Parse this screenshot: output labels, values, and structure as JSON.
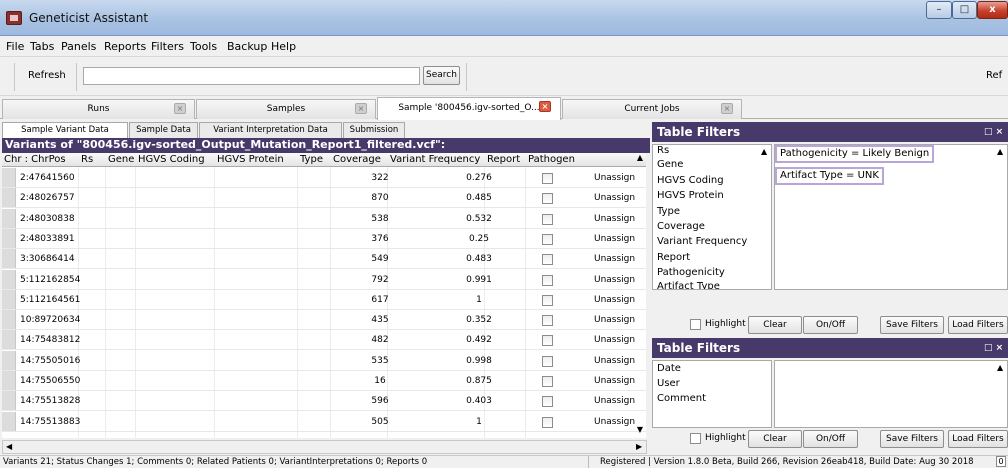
{
  "window": {
    "title": "Geneticist Assistant",
    "minimize": "–",
    "maximize": "□",
    "close": "x"
  },
  "menu": [
    "File",
    "Tabs",
    "Panels",
    "Reports",
    "Filters",
    "Tools",
    "Backup",
    "Help"
  ],
  "toolbar": {
    "refresh": "Refresh",
    "search_value": "",
    "search_button": "Search",
    "right_label": "Ref"
  },
  "tabs": [
    {
      "label": "Runs"
    },
    {
      "label": "Samples"
    },
    {
      "label": "Sample '800456.igv-sorted_O..."
    },
    {
      "label": "Current Jobs"
    }
  ],
  "subtabs": [
    "Sample Variant Data",
    "Sample Data",
    "Variant Interpretation Data",
    "Submission"
  ],
  "variants": {
    "header": "Variants of \"800456.igv-sorted_Output_Mutation_Report1_filtered.vcf\":",
    "columns": [
      "Chr : ChrPos",
      "Rs",
      "Gene",
      "HGVS Coding",
      "HGVS Protein",
      "Type",
      "Coverage",
      "Variant Frequency",
      "Report",
      "Pathogen"
    ],
    "rows": [
      {
        "chr": "2:47641560",
        "coverage": "322",
        "freq": "0.276",
        "path": "Unassign"
      },
      {
        "chr": "2:48026757",
        "coverage": "870",
        "freq": "0.485",
        "path": "Unassign"
      },
      {
        "chr": "2:48030838",
        "coverage": "538",
        "freq": "0.532",
        "path": "Unassign"
      },
      {
        "chr": "2:48033891",
        "coverage": "376",
        "freq": "0.25",
        "path": "Unassign"
      },
      {
        "chr": "3:30686414",
        "coverage": "549",
        "freq": "0.483",
        "path": "Unassign"
      },
      {
        "chr": "5:112162854",
        "coverage": "792",
        "freq": "0.991",
        "path": "Unassign"
      },
      {
        "chr": "5:112164561",
        "coverage": "617",
        "freq": "1",
        "path": "Unassign"
      },
      {
        "chr": "10:89720634",
        "coverage": "435",
        "freq": "0.352",
        "path": "Unassign"
      },
      {
        "chr": "14:75483812",
        "coverage": "482",
        "freq": "0.492",
        "path": "Unassign"
      },
      {
        "chr": "14:75505016",
        "coverage": "535",
        "freq": "0.998",
        "path": "Unassign"
      },
      {
        "chr": "14:75506550",
        "coverage": "16",
        "freq": "0.875",
        "path": "Unassign"
      },
      {
        "chr": "14:75513828",
        "coverage": "596",
        "freq": "0.403",
        "path": "Unassign"
      },
      {
        "chr": "14:75513883",
        "coverage": "505",
        "freq": "1",
        "path": "Unassign"
      }
    ]
  },
  "filters_top": {
    "title": "Table Filters",
    "pin": "□ ×",
    "fields": [
      "Rs",
      "Gene",
      "HGVS Coding",
      "HGVS Protein",
      "Type",
      "Coverage",
      "Variant Frequency",
      "Report",
      "Pathogenicity",
      "Artifact Type"
    ],
    "active": [
      "Pathogenicity = Likely Benign",
      "Artifact Type = UNK"
    ],
    "highlight": "Highlight",
    "buttons": [
      "Clear",
      "On/Off",
      "Save Filters",
      "Load Filters"
    ]
  },
  "filters_bottom": {
    "title": "Table Filters",
    "pin": "□ ×",
    "fields": [
      "Date",
      "User",
      "Comment"
    ],
    "highlight": "Highlight",
    "buttons": [
      "Clear",
      "On/Off",
      "Save Filters",
      "Load Filters"
    ]
  },
  "status": {
    "left": "Variants 21; Status Changes 1; Comments 0; Related Patients 0; VariantInterpretations 0; Reports 0",
    "registered": "Registered",
    "version": "Version 1.8.0 Beta, Build 266, Revision 26eab418, Build Date: Aug 30 2018",
    "count": "0"
  }
}
